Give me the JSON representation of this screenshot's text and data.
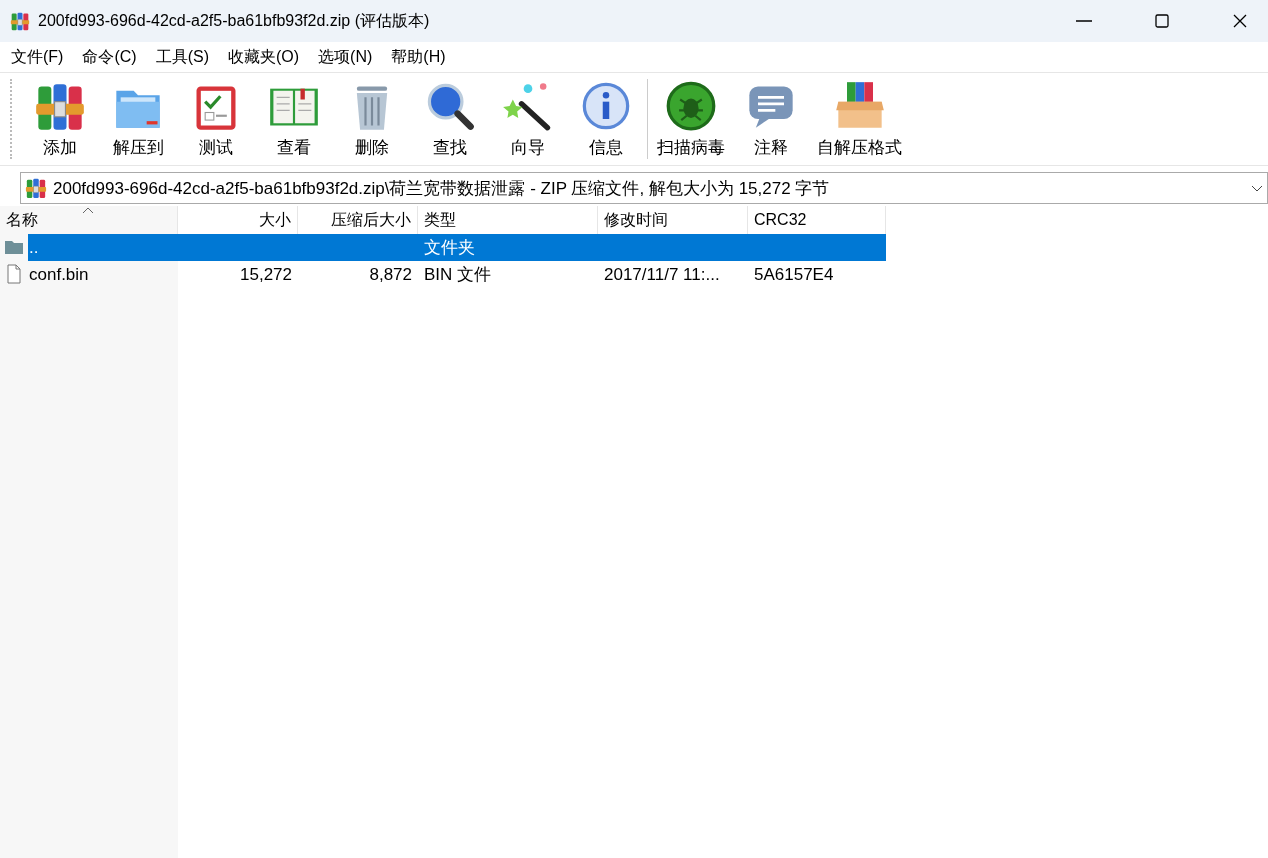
{
  "window": {
    "title": "200fd993-696d-42cd-a2f5-ba61bfb93f2d.zip (评估版本)"
  },
  "menu": [
    "文件(F)",
    "命令(C)",
    "工具(S)",
    "收藏夹(O)",
    "选项(N)",
    "帮助(H)"
  ],
  "toolbar": [
    {
      "label": "添加"
    },
    {
      "label": "解压到"
    },
    {
      "label": "测试"
    },
    {
      "label": "查看"
    },
    {
      "label": "删除"
    },
    {
      "label": "查找"
    },
    {
      "label": "向导"
    },
    {
      "label": "信息"
    },
    {
      "label": "扫描病毒"
    },
    {
      "label": "注释"
    },
    {
      "label": "自解压格式"
    }
  ],
  "address": "200fd993-696d-42cd-a2f5-ba61bfb93f2d.zip\\荷兰宽带数据泄露 - ZIP 压缩文件, 解包大小为 15,272 字节",
  "table": {
    "columns": [
      "名称",
      "大小",
      "压缩后大小",
      "类型",
      "修改时间",
      "CRC32"
    ],
    "rows": [
      {
        "kind": "folder",
        "selected": true,
        "cells": [
          "..",
          "",
          "",
          "文件夹",
          "",
          ""
        ]
      },
      {
        "kind": "file",
        "selected": false,
        "cells": [
          "conf.bin",
          "15,272",
          "8,872",
          "BIN 文件",
          "2017/11/7 11:...",
          "5A6157E4"
        ]
      }
    ]
  }
}
